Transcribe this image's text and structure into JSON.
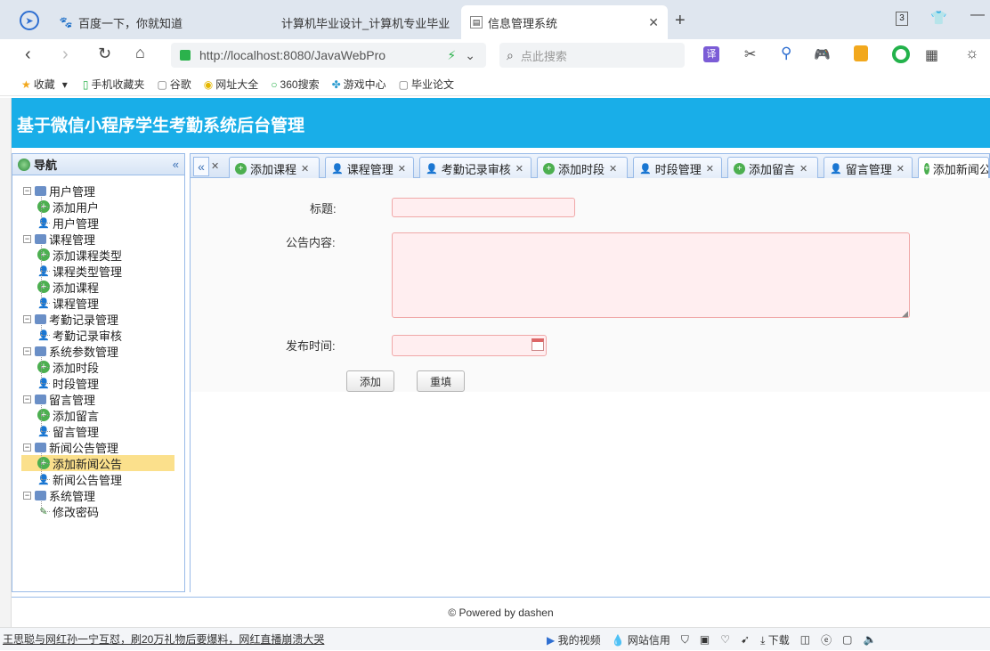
{
  "browser": {
    "tabs": [
      {
        "label": "百度一下，你就知道",
        "icon": "paw-icon"
      },
      {
        "label": "计算机毕业设计_计算机专业毕业",
        "icon": "none"
      },
      {
        "label": "信息管理系统",
        "icon": "page-icon",
        "active": true
      }
    ],
    "tab_count": "3",
    "url": "http://localhost:8080/JavaWebPro",
    "search_placeholder": "点此搜索",
    "translate_label": "译",
    "bookmarks": [
      "收藏",
      "手机收藏夹",
      "谷歌",
      "网址大全",
      "360搜索",
      "游戏中心",
      "毕业论文"
    ]
  },
  "app": {
    "title": "基于微信小程序学生考勤系统后台管理"
  },
  "nav": {
    "header": "导航",
    "collapse": "«",
    "groups": [
      {
        "label": "用户管理",
        "items": [
          "添加用户",
          "用户管理"
        ]
      },
      {
        "label": "课程管理",
        "items": [
          "添加课程类型",
          "课程类型管理",
          "添加课程",
          "课程管理"
        ]
      },
      {
        "label": "考勤记录管理",
        "items": [
          "考勤记录审核"
        ]
      },
      {
        "label": "系统参数管理",
        "items": [
          "添加时段",
          "时段管理"
        ]
      },
      {
        "label": "留言管理",
        "items": [
          "添加留言",
          "留言管理"
        ]
      },
      {
        "label": "新闻公告管理",
        "items": [
          "添加新闻公告",
          "新闻公告管理"
        ]
      },
      {
        "label": "系统管理",
        "items": [
          "修改密码"
        ]
      }
    ],
    "selected": "添加新闻公告"
  },
  "content_tabs": {
    "scroll_left": "«",
    "tabs": [
      "添加课程",
      "课程管理",
      "考勤记录审核",
      "添加时段",
      "时段管理",
      "添加留言",
      "留言管理",
      "添加新闻公告"
    ]
  },
  "form": {
    "title_label": "标题:",
    "content_label": "公告内容:",
    "time_label": "发布时间:",
    "title_value": "",
    "content_value": "",
    "time_value": "",
    "add_button": "添加",
    "reset_button": "重填"
  },
  "footer": "© Powered by dashen",
  "status": {
    "news": "王思聪与网红孙一宁互怼，刷20万礼物后要爆料，网红直播崩溃大哭",
    "video": "我的视频",
    "network": "网站信用",
    "download": "下载"
  }
}
